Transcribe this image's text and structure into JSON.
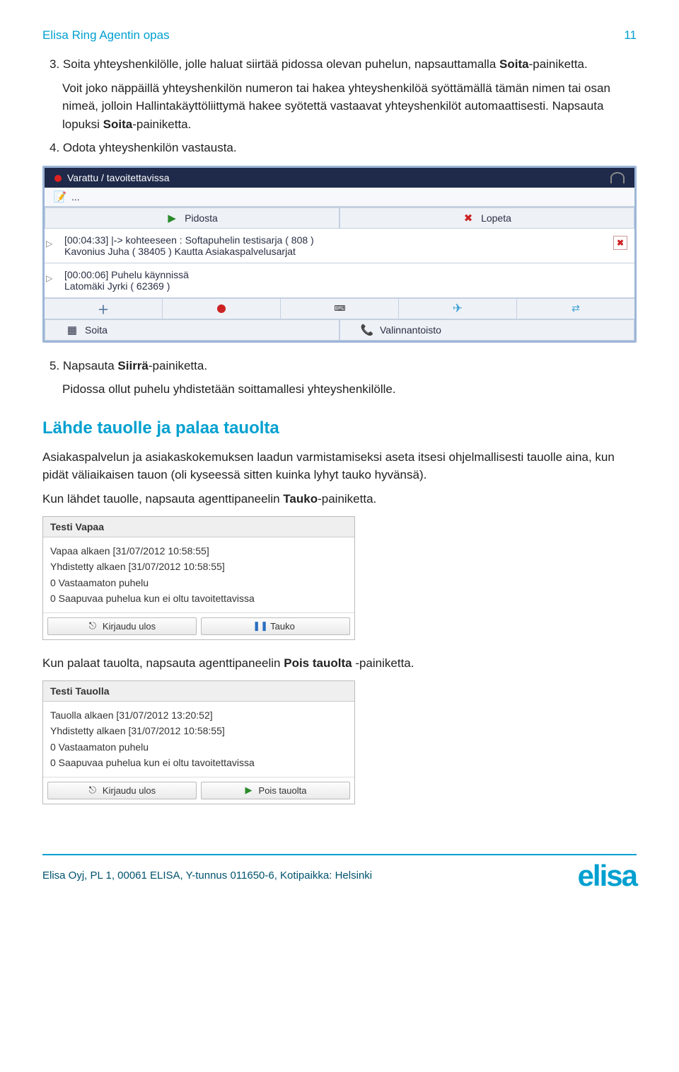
{
  "header": {
    "title": "Elisa Ring Agentin opas",
    "page": "11"
  },
  "para": {
    "p1a": "3.  Soita yhteyshenkilölle, jolle haluat siirtää pidossa olevan puhelun, napsauttamalla ",
    "p1b": "Soita",
    "p1c": "-painiketta.",
    "p2a": "Voit joko näppäillä yhteyshenkilön numeron tai hakea yhteyshenkilöä syöttämällä tämän nimen tai osan nimeä, jolloin Hallintakäyttöliittymä hakee syötettä vastaavat yhteyshenkilöt automaattisesti. Napsauta lopuksi ",
    "p2b": "Soita",
    "p2c": "-painiketta.",
    "p3": "4.  Odota yhteyshenkilön vastausta.",
    "p4a": "5.  Napsauta ",
    "p4b": "Siirrä",
    "p4c": "-painiketta.",
    "p5": "Pidossa ollut puhelu yhdistetään soittamallesi yhteyshenkilölle."
  },
  "h2": "Lähde tauolle ja palaa tauolta",
  "para2": {
    "p1": "Asiakaspalvelun ja asiakaskokemuksen laadun varmistamiseksi aseta itsesi ohjelmallisesti tauolle aina, kun pidät väliaikaisen tauon (oli kyseessä sitten kuinka lyhyt tauko hyvänsä).",
    "p2a": "Kun lähdet tauolle, napsauta agenttipaneelin ",
    "p2b": "Tauko",
    "p2c": "-painiketta.",
    "p3a": "Kun palaat tauolta, napsauta agenttipaneelin ",
    "p3b": "Pois tauolta",
    "p3c": " -painiketta."
  },
  "shot1": {
    "status": "Varattu / tavoitettavissa",
    "note": "...",
    "btn_hold": "Pidosta",
    "btn_end": "Lopeta",
    "call1_line1": "[00:04:33] |-> kohteeseen : Softapuhelin testisarja ( 808 )",
    "call1_line2": "Kavonius Juha ( 38405 ) Kautta Asiakaspalvelusarjat",
    "call2_line1": "[00:00:06] Puhelu käynnissä",
    "call2_line2": "Latomäki Jyrki ( 62369 )",
    "btn_dial": "Soita",
    "btn_pickup": "Valinnantoisto"
  },
  "shot2": {
    "title": "Testi Vapaa",
    "l1": "Vapaa alkaen [31/07/2012 10:58:55]",
    "l2": "Yhdistetty alkaen [31/07/2012 10:58:55]",
    "l3": "0 Vastaamaton puhelu",
    "l4": "0 Saapuvaa puhelua kun ei oltu tavoitettavissa",
    "btn1": "Kirjaudu ulos",
    "btn2": "Tauko"
  },
  "shot3": {
    "title": "Testi Tauolla",
    "l1": "Tauolla alkaen [31/07/2012 13:20:52]",
    "l2": "Yhdistetty alkaen [31/07/2012 10:58:55]",
    "l3": "0 Vastaamaton puhelu",
    "l4": "0 Saapuvaa puhelua kun ei oltu tavoitettavissa",
    "btn1": "Kirjaudu ulos",
    "btn2": "Pois tauolta"
  },
  "footer": {
    "text": "Elisa Oyj, PL 1, 00061 ELISA, Y-tunnus 011650-6, Kotipaikka: Helsinki",
    "logo": "elisa"
  }
}
